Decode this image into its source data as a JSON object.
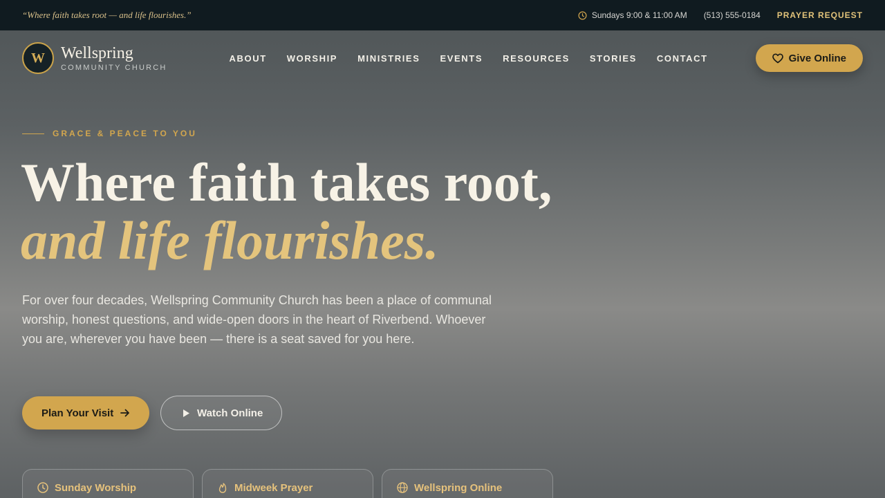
{
  "topbar": {
    "tagline": "“Where faith takes root — and life flourishes.”",
    "service_times": "Sundays 9:00 & 11:00 AM",
    "phone": "(513) 555-0184",
    "prayer_request": "PRAYER REQUEST",
    "icons": {
      "service_times": "clock-icon"
    }
  },
  "nav": {
    "logo_mark": "W",
    "logo_name": "Wellspring",
    "logo_sub": "COMMUNITY CHURCH",
    "items": [
      {
        "label": "ABOUT"
      },
      {
        "label": "WORSHIP"
      },
      {
        "label": "MINISTRIES"
      },
      {
        "label": "EVENTS"
      },
      {
        "label": "RESOURCES"
      },
      {
        "label": "STORIES"
      },
      {
        "label": "CONTACT"
      }
    ],
    "give_label": "Give Online",
    "give_icon": "heart-icon"
  },
  "hero": {
    "eyebrow": "GRACE & PEACE TO YOU",
    "headline_line1": "Where faith takes root,",
    "headline_line2": "and life flourishes.",
    "lead": "For over four decades, Wellspring Community Church has been a place of communal worship, honest questions, and wide-open doors in the heart of Riverbend. Whoever you are, wherever you have been — there is a seat saved for you here.",
    "primary_cta": "Plan Your Visit",
    "primary_cta_icon": "arrow-right-icon",
    "secondary_cta": "Watch Online",
    "secondary_cta_icon": "play-icon"
  },
  "cards": [
    {
      "title": "Sunday Worship",
      "icon": "clock-icon"
    },
    {
      "title": "Midweek Prayer",
      "icon": "flame-icon"
    },
    {
      "title": "Wellspring Online",
      "icon": "globe-icon"
    }
  ],
  "colors": {
    "accent_gold": "#d2a64e",
    "topbar_bg": "#101b20",
    "headline_italic": "#e4c47d"
  }
}
